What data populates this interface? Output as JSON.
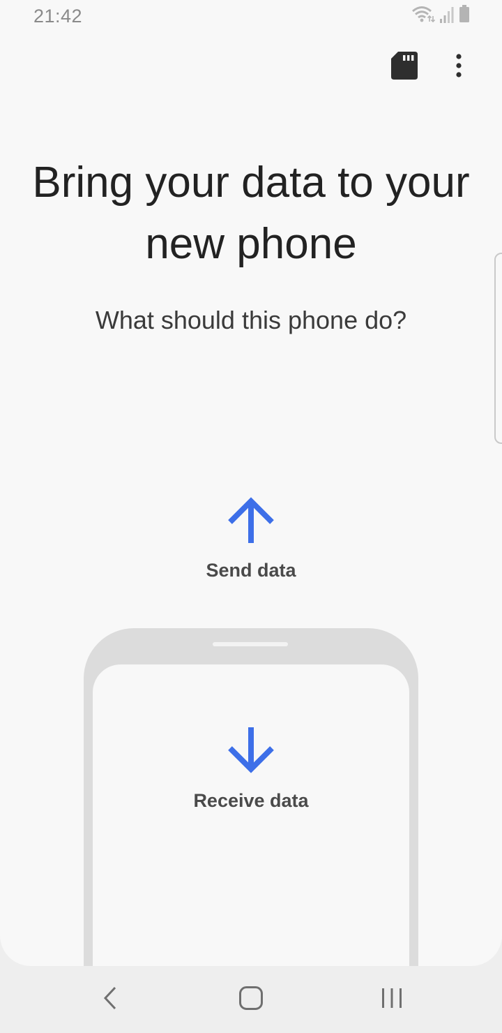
{
  "status_bar": {
    "time": "21:42",
    "icons": [
      "wifi-icon",
      "signal-icon",
      "battery-icon"
    ]
  },
  "toolbar": {
    "icons": [
      "sd-card-icon",
      "more-vert-icon"
    ]
  },
  "main": {
    "title": "Bring your data to your new phone",
    "subtitle": "What should this phone do?"
  },
  "options": {
    "send": {
      "label": "Send data",
      "icon": "arrow-up-icon"
    },
    "receive": {
      "label": "Receive data",
      "icon": "arrow-down-icon"
    }
  },
  "nav_bar": {
    "icons": [
      "back-icon",
      "home-icon",
      "recent-apps-icon"
    ]
  },
  "colors": {
    "accent": "#3d6fe8",
    "background": "#f8f8f8",
    "text_primary": "#222222"
  }
}
